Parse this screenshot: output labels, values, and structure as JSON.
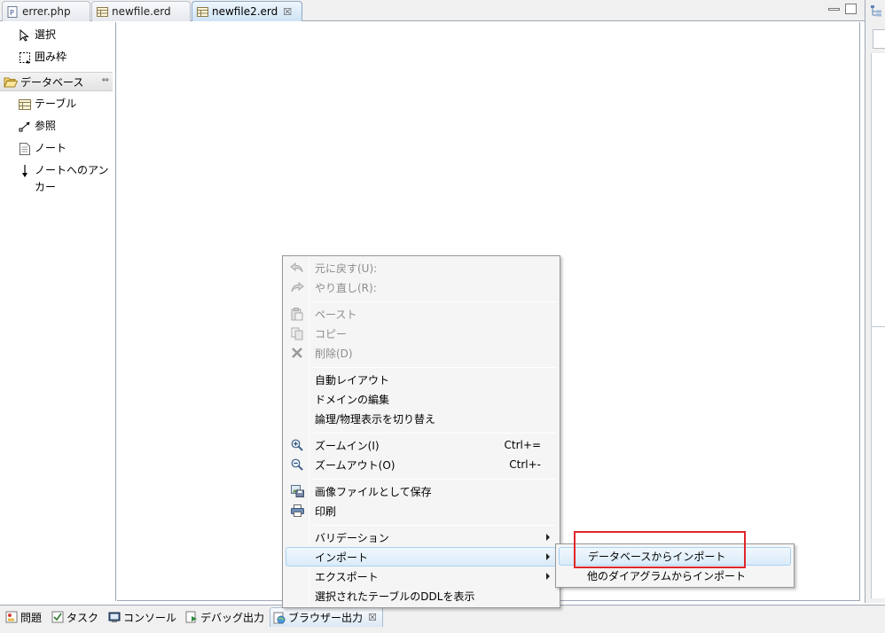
{
  "editor_tabs": [
    {
      "label": "errer.php",
      "icon": "php-file-icon",
      "active": false
    },
    {
      "label": "newfile.erd",
      "icon": "erd-file-icon",
      "active": false
    },
    {
      "label": "newfile2.erd",
      "icon": "erd-file-icon",
      "active": true,
      "close": "☒"
    }
  ],
  "palette": {
    "select": "選択",
    "marquee": "囲み枠",
    "drawer": "データベース",
    "drawer_pin": "⇔",
    "items": [
      {
        "label": "テーブル",
        "icon": "table-icon"
      },
      {
        "label": "参照",
        "icon": "reference-icon"
      },
      {
        "label": "ノート",
        "icon": "note-icon"
      },
      {
        "label": "ノートへのアンカー",
        "icon": "anchor-arrow-icon"
      }
    ]
  },
  "context_menu": {
    "undo": "元に戻す(U):",
    "redo": "やり直し(R):",
    "paste": "ペースト",
    "copy": "コピー",
    "delete": "削除(D)",
    "auto_layout": "自動レイアウト",
    "edit_domain": "ドメインの編集",
    "toggle_view": "論理/物理表示を切り替え",
    "zoom_in": "ズームイン(I)",
    "zoom_in_shortcut": "Ctrl+=",
    "zoom_out": "ズームアウト(O)",
    "zoom_out_shortcut": "Ctrl+-",
    "save_image": "画像ファイルとして保存",
    "print": "印刷",
    "validation": "バリデーション",
    "import": "インポート",
    "export": "エクスポート",
    "show_ddl": "選択されたテーブルのDDLを表示"
  },
  "submenu": {
    "import_from_db": "データベースからインポート",
    "import_from_diagram": "他のダイアグラムからインポート"
  },
  "bottom_tabs": [
    {
      "label": "問題",
      "icon": "problems-icon"
    },
    {
      "label": "タスク",
      "icon": "tasks-icon"
    },
    {
      "label": "コンソール",
      "icon": "console-icon"
    },
    {
      "label": "デバッグ出力",
      "icon": "debug-output-icon"
    },
    {
      "label": "ブラウザー出力",
      "icon": "browser-output-icon",
      "active": true,
      "close": "☒"
    }
  ],
  "colors": {
    "highlight_border": "#e0262b",
    "menu_hover": "#d9ebf9",
    "disabled_text": "#8d8d8d"
  }
}
